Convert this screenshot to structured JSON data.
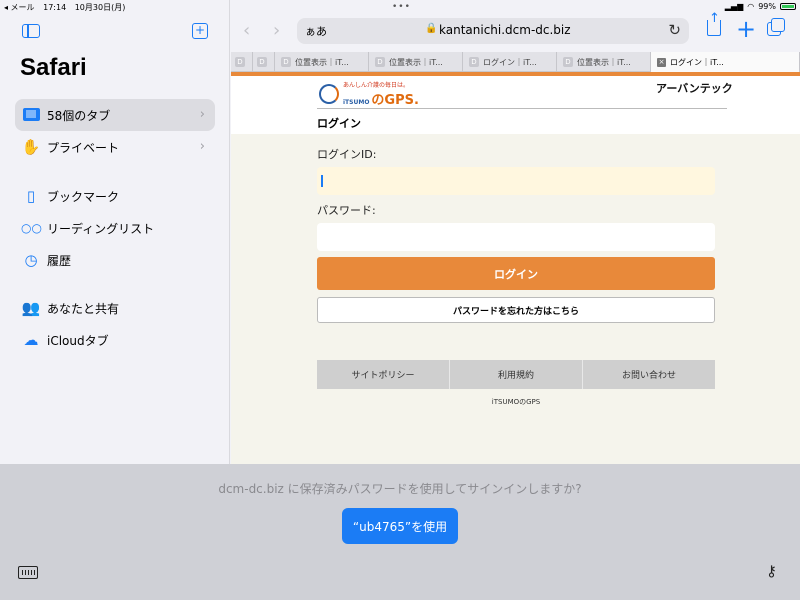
{
  "status": {
    "back_app": "◂ メール",
    "time": "17:14",
    "date": "10月30日(月)",
    "battery": "99%"
  },
  "sidebar": {
    "title": "Safari",
    "items": [
      {
        "label": "58個のタブ",
        "icon": "tabs-icon"
      },
      {
        "label": "プライベート",
        "icon": "hand-icon"
      },
      {
        "label": "ブックマーク",
        "icon": "bookmark-icon"
      },
      {
        "label": "リーディングリスト",
        "icon": "glasses-icon"
      },
      {
        "label": "履歴",
        "icon": "clock-icon"
      },
      {
        "label": "あなたと共有",
        "icon": "people-icon"
      },
      {
        "label": "iCloudタブ",
        "icon": "cloud-icon"
      }
    ]
  },
  "toolbar": {
    "aa": "ぁあ",
    "url": "kantanichi.dcm-dc.biz"
  },
  "tabs": [
    {
      "label": "",
      "favicon": "D"
    },
    {
      "label": "",
      "favicon": "D"
    },
    {
      "label": "位置表示｜iT...",
      "favicon": "D"
    },
    {
      "label": "位置表示｜iT...",
      "favicon": "D"
    },
    {
      "label": "ログイン｜iT...",
      "favicon": "D"
    },
    {
      "label": "位置表示｜iT...",
      "favicon": "D"
    },
    {
      "label": "ログイン｜iT...",
      "favicon": "×"
    }
  ],
  "page": {
    "logo_slogan": "あんしん介護の毎日は。",
    "logo_small": "iTSUMO",
    "logo_brand": "のGPS.",
    "company": "アーバンテック",
    "title": "ログイン",
    "login_id_label": "ログインID:",
    "password_label": "パスワード:",
    "login_button": "ログイン",
    "forgot_button": "パスワードを忘れた方はこちら",
    "footer_links": [
      "サイトポリシー",
      "利用規約",
      "お問い合わせ"
    ],
    "copyright": "iTSUMOのGPS"
  },
  "password_bar": {
    "prompt": "dcm-dc.biz に保存済みパスワードを使用してサインインしますか?",
    "use_button": "“ub4765”を使用"
  },
  "colors": {
    "accent": "#1b7cf5",
    "brand_orange": "#e8893a"
  }
}
